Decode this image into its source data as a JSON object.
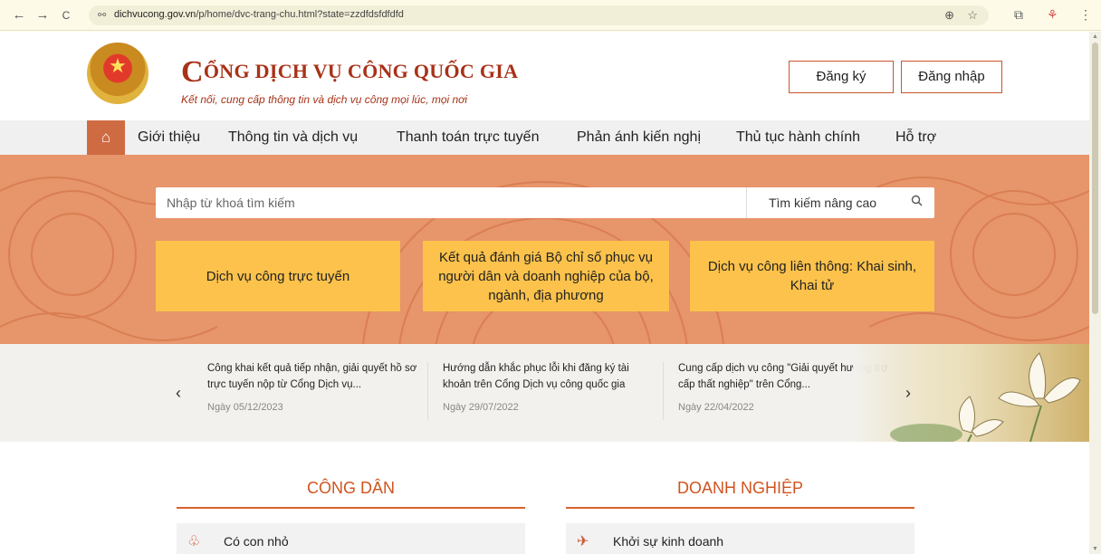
{
  "browser": {
    "back": "←",
    "forward": "→",
    "reload": "C",
    "site_icon": "⚯",
    "url_domain": "dichvucong.gov.vn",
    "url_path": "/p/home/dvc-trang-chu.html?state=zzdfdsfdfdfd",
    "zoom_icon": "zoom-icon",
    "bookmark_icon": "star-icon"
  },
  "header": {
    "brand_first_letter": "C",
    "brand_rest": "ỔNG DỊCH VỤ CÔNG QUỐC GIA",
    "tagline": "Kết nối, cung cấp thông tin và dịch vụ công mọi lúc, mọi nơi",
    "register_label": "Đăng ký",
    "login_label": "Đăng nhập"
  },
  "menu": {
    "home_icon": "⌂",
    "items": [
      "Giới thiệu",
      "Thông tin và dịch vụ",
      "Thanh toán trực tuyến",
      "Phản ánh kiến nghị",
      "Thủ tục hành chính",
      "Hỗ trợ"
    ]
  },
  "search": {
    "placeholder": "Nhập từ khoá tìm kiếm",
    "advanced_label": "Tìm kiếm nâng cao",
    "icon": "search-icon"
  },
  "cta": {
    "online_services": "Dịch vụ công trực tuyến",
    "evaluation": "Kết quả đánh giá Bộ chỉ số phục vụ người dân và doanh nghiệp của bộ, ngành, địa phương",
    "linked_services": "Dịch vụ công liên thông: Khai sinh, Khai tử"
  },
  "news": {
    "items": [
      {
        "title": "Công khai kết quả tiếp nhận, giải quyết hồ sơ trực tuyến nộp từ Cổng Dịch vụ...",
        "date": "Ngày 05/12/2023"
      },
      {
        "title": "Hướng dẫn khắc phục lỗi khi đăng ký tài khoản trên Cổng Dịch vụ công quốc gia",
        "date": "Ngày 29/07/2022"
      },
      {
        "title": "Cung cấp dịch vụ công \"Giải quyết hưởng trợ cấp thất nghiệp\" trên Cổng...",
        "date": "Ngày 22/04/2022"
      }
    ],
    "prev_arrow": "‹",
    "next_arrow": "›"
  },
  "sections": {
    "citizen_title": "CÔNG DÂN",
    "business_title": "DOANH NGHIỆP",
    "citizen_first": "Có con nhỏ",
    "business_first": "Khởi sự kinh doanh"
  },
  "colors": {
    "brand_red": "#a83218",
    "accent_orange": "#cf6b43",
    "hero_bg": "#e7956a",
    "cta_yellow": "#fcc24b"
  }
}
